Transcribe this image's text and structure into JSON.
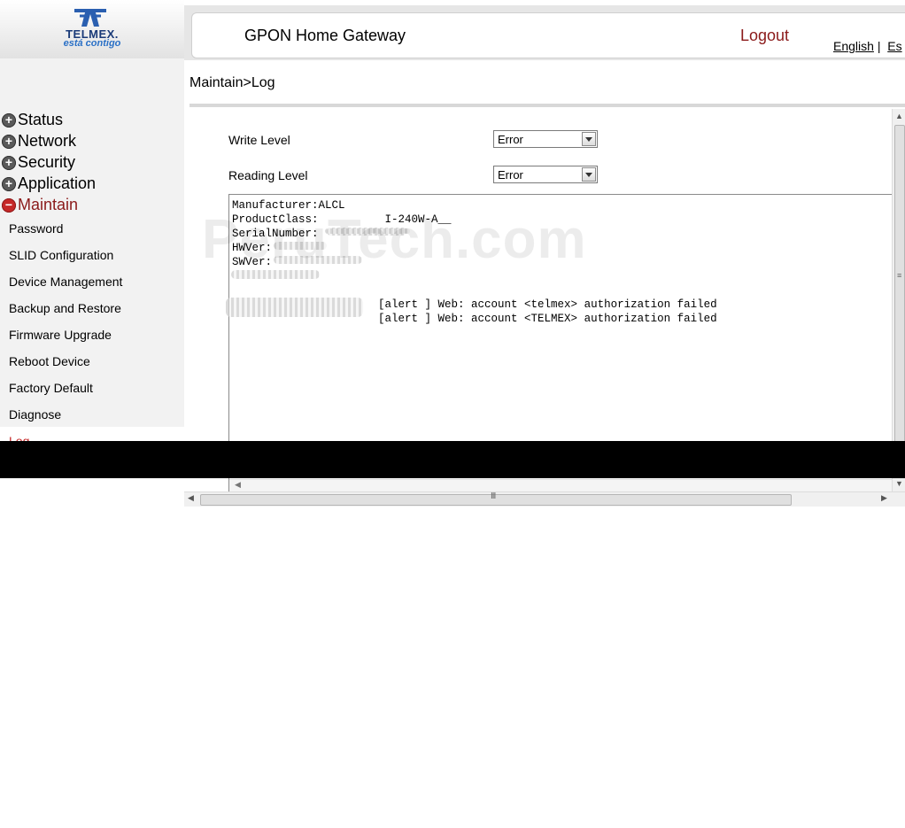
{
  "logo": {
    "brand": "TELMEX.",
    "tagline": "está contigo"
  },
  "header": {
    "title": "GPON Home Gateway",
    "logout": "Logout",
    "lang_english": "English",
    "lang_separator": "|",
    "lang_other": "Es"
  },
  "breadcrumb": "Maintain>Log",
  "sidebar": {
    "groups": [
      {
        "label": "Status",
        "icon": "plus-icon"
      },
      {
        "label": "Network",
        "icon": "plus-icon"
      },
      {
        "label": "Security",
        "icon": "plus-icon"
      },
      {
        "label": "Application",
        "icon": "plus-icon"
      },
      {
        "label": "Maintain",
        "icon": "minus-icon"
      }
    ],
    "items": [
      "Password",
      "SLID Configuration",
      "Device Management",
      "Backup and Restore",
      "Firmware Upgrade",
      "Reboot Device",
      "Factory Default",
      "Diagnose",
      "Log"
    ]
  },
  "form": {
    "write_level_label": "Write Level",
    "write_level_value": "Error",
    "reading_level_label": "Reading Level",
    "reading_level_value": "Error"
  },
  "log": {
    "lines": [
      "Manufacturer:ALCL",
      "ProductClass:          I-240W-A__",
      "SerialNumber:",
      "HWVer:",
      "SWVer:",
      "",
      "",
      "                      [alert ] Web: account <telmex> authorization failed",
      "                      [alert ] Web: account <TELMEX> authorization failed"
    ]
  },
  "watermark": "PeruTech.com",
  "colors": {
    "accent_red": "#8b1a1a",
    "active_item": "#c62828",
    "logo_blue": "#1a3a78"
  }
}
